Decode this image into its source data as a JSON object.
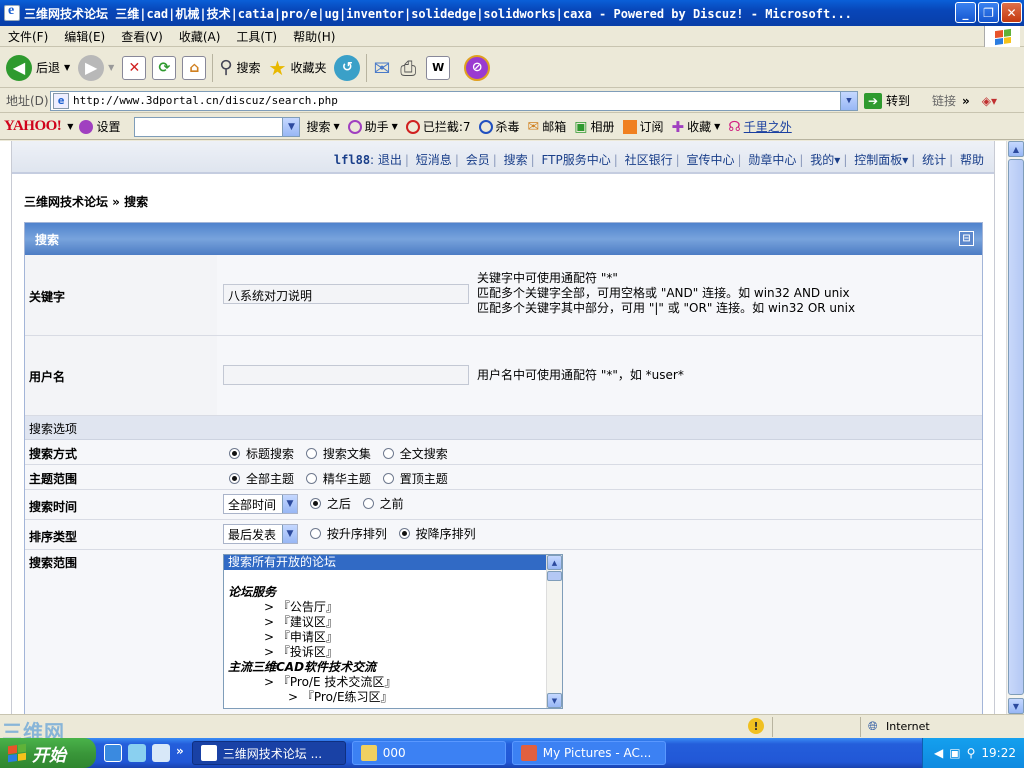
{
  "window": {
    "title": "三维网技术论坛 三维|cad|机械|技术|catia|pro/e|ug|inventor|solidedge|solidworks|caxa - Powered by Discuz! - Microsoft...",
    "minimize": "_",
    "maximize": "❐",
    "close": "✕"
  },
  "menubar": [
    "文件(F)",
    "编辑(E)",
    "查看(V)",
    "收藏(A)",
    "工具(T)",
    "帮助(H)"
  ],
  "toolbar": {
    "back": "后退",
    "search": "搜索",
    "favorites": "收藏夹"
  },
  "address": {
    "label": "地址(D)",
    "url": "http://www.3dportal.cn/discuz/search.php",
    "go": "转到",
    "links": "链接"
  },
  "yahoo": {
    "logo": "YAHOO!",
    "settings": "设置",
    "search": "搜索",
    "helper": "助手",
    "blocked": "已拦截:7",
    "antivirus": "杀毒",
    "mail": "邮箱",
    "album": "相册",
    "rss": "订阅",
    "favorites": "收藏",
    "qianli": "千里之外"
  },
  "forum_nav": {
    "username": "lfl88",
    "items": [
      "退出",
      "短消息",
      "会员",
      "搜索",
      "FTP服务中心",
      "社区银行",
      "宣传中心",
      "勋章中心",
      "我的▾",
      "控制面板▾",
      "统计",
      "帮助"
    ]
  },
  "breadcrumb": "三维网技术论坛 » 搜索",
  "form": {
    "header": "搜索",
    "keyword": {
      "label": "关键字",
      "value": "八系统对刀说明",
      "hint1": "关键字中可使用通配符 \"*\"",
      "hint2": "匹配多个关键字全部，可用空格或 \"AND\" 连接。如 win32 AND unix",
      "hint3": "匹配多个关键字其中部分，可用 \"|\" 或 \"OR\" 连接。如 win32 OR unix"
    },
    "username": {
      "label": "用户名",
      "value": "",
      "hint": "用户名中可使用通配符 \"*\"，如 *user*"
    },
    "options_header": "搜索选项",
    "mode": {
      "label": "搜索方式",
      "options": [
        "标题搜索",
        "搜索文集",
        "全文搜索"
      ],
      "selected": 0
    },
    "scope": {
      "label": "主题范围",
      "options": [
        "全部主题",
        "精华主题",
        "置顶主题"
      ],
      "selected": 0
    },
    "time": {
      "label": "搜索时间",
      "select_value": "全部时间",
      "options": [
        "之后",
        "之前"
      ],
      "selected": 0
    },
    "sort": {
      "label": "排序类型",
      "select_value": "最后发表",
      "options": [
        "按升序排列",
        "按降序排列"
      ],
      "selected": 1
    },
    "forums": {
      "label": "搜索范围",
      "items": [
        {
          "text": "搜索所有开放的论坛",
          "kind": "selected"
        },
        {
          "text": "",
          "kind": "blank"
        },
        {
          "text": "论坛服务",
          "kind": "group"
        },
        {
          "text": "　　　> 『公告厅』",
          "kind": "item"
        },
        {
          "text": "　　　> 『建议区』",
          "kind": "item"
        },
        {
          "text": "　　　> 『申请区』",
          "kind": "item"
        },
        {
          "text": "　　　> 『投诉区』",
          "kind": "item"
        },
        {
          "text": "主流三维CAD软件技术交流",
          "kind": "group"
        },
        {
          "text": "　　　> 『Pro/E 技术交流区』",
          "kind": "item"
        },
        {
          "text": "　　　　　> 『Pro/E练习区』",
          "kind": "item"
        }
      ]
    }
  },
  "statusbar": {
    "watermark": "三维网",
    "zone": "Internet"
  },
  "taskbar": {
    "start": "开始",
    "tasks": [
      "三维网技术论坛 ...",
      "000",
      "My Pictures - AC..."
    ],
    "clock": "19:22"
  },
  "colors": {
    "title_blue": "#0a5fd8",
    "form_header": "#4f82cc",
    "selected_blue": "#316ac5",
    "taskbar_green": "#3a973a"
  }
}
